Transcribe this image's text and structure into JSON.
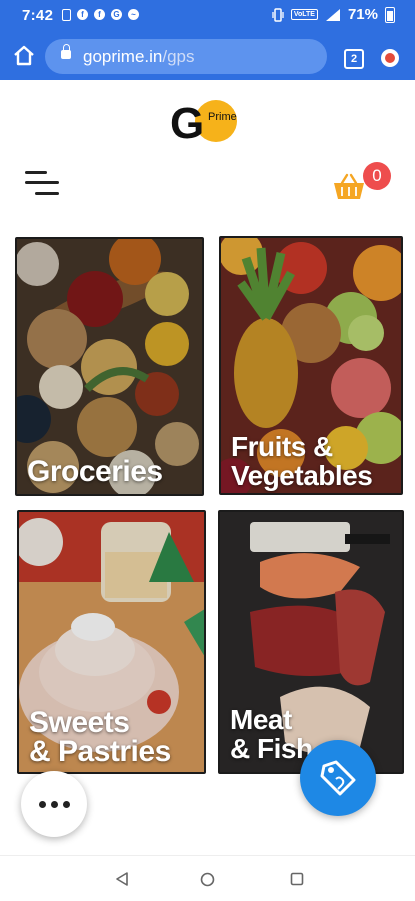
{
  "status_bar": {
    "time": "7:42",
    "battery": "71%",
    "network": "VoLTE",
    "notification_icons": [
      "sim-icon",
      "facebook-icon",
      "facebook-icon",
      "google-icon",
      "messenger-icon"
    ]
  },
  "browser": {
    "url_domain": "goprime.in",
    "url_path": "/gps",
    "tab_count": "2"
  },
  "header": {
    "logo_letter": "G",
    "logo_word": "Prime",
    "cart_count": "0"
  },
  "categories": [
    {
      "label": "Groceries"
    },
    {
      "label": "Fruits &\nVegetables"
    },
    {
      "label": "Sweets\n& Pastries"
    },
    {
      "label": "Meat\n& Fish"
    }
  ],
  "colors": {
    "chrome_blue": "#2f6fe0",
    "fab_blue": "#1e88e5",
    "cart_orange": "#f5a623",
    "badge_red": "#ee4d4d"
  }
}
